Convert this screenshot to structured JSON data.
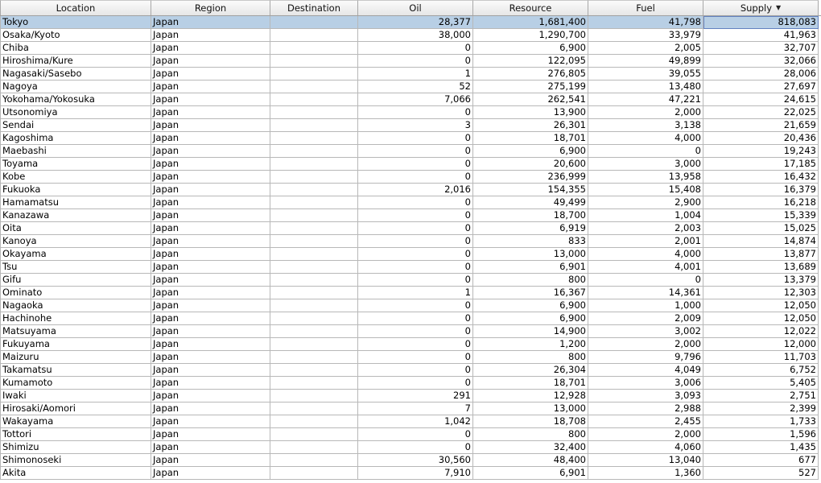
{
  "columns": [
    {
      "label": "Location",
      "align": "left"
    },
    {
      "label": "Region",
      "align": "left"
    },
    {
      "label": "Destination",
      "align": "left"
    },
    {
      "label": "Oil",
      "align": "right"
    },
    {
      "label": "Resource",
      "align": "right"
    },
    {
      "label": "Fuel",
      "align": "right"
    },
    {
      "label": "Supply",
      "align": "right",
      "sorted": "descending",
      "sort_icon": "sort-descending-icon"
    }
  ],
  "selected_row": 0,
  "colors": {
    "selection": "#b8cfe5",
    "focus_border": "#6382bf",
    "grid": "#b8b8b8"
  },
  "rows": [
    [
      "Tokyo",
      "Japan",
      "",
      "28,377",
      "1,681,400",
      "41,798",
      "818,083"
    ],
    [
      "Osaka/Kyoto",
      "Japan",
      "",
      "38,000",
      "1,290,700",
      "33,979",
      "41,963"
    ],
    [
      "Chiba",
      "Japan",
      "",
      "0",
      "6,900",
      "2,005",
      "32,707"
    ],
    [
      "Hiroshima/Kure",
      "Japan",
      "",
      "0",
      "122,095",
      "49,899",
      "32,066"
    ],
    [
      "Nagasaki/Sasebo",
      "Japan",
      "",
      "1",
      "276,805",
      "39,055",
      "28,006"
    ],
    [
      "Nagoya",
      "Japan",
      "",
      "52",
      "275,199",
      "13,480",
      "27,697"
    ],
    [
      "Yokohama/Yokosuka",
      "Japan",
      "",
      "7,066",
      "262,541",
      "47,221",
      "24,615"
    ],
    [
      "Utsonomiya",
      "Japan",
      "",
      "0",
      "13,900",
      "2,000",
      "22,025"
    ],
    [
      "Sendai",
      "Japan",
      "",
      "3",
      "26,301",
      "3,138",
      "21,659"
    ],
    [
      "Kagoshima",
      "Japan",
      "",
      "0",
      "18,701",
      "4,000",
      "20,436"
    ],
    [
      "Maebashi",
      "Japan",
      "",
      "0",
      "6,900",
      "0",
      "19,243"
    ],
    [
      "Toyama",
      "Japan",
      "",
      "0",
      "20,600",
      "3,000",
      "17,185"
    ],
    [
      "Kobe",
      "Japan",
      "",
      "0",
      "236,999",
      "13,958",
      "16,432"
    ],
    [
      "Fukuoka",
      "Japan",
      "",
      "2,016",
      "154,355",
      "15,408",
      "16,379"
    ],
    [
      "Hamamatsu",
      "Japan",
      "",
      "0",
      "49,499",
      "2,900",
      "16,218"
    ],
    [
      "Kanazawa",
      "Japan",
      "",
      "0",
      "18,700",
      "1,004",
      "15,339"
    ],
    [
      "Oita",
      "Japan",
      "",
      "0",
      "6,919",
      "2,003",
      "15,025"
    ],
    [
      "Kanoya",
      "Japan",
      "",
      "0",
      "833",
      "2,001",
      "14,874"
    ],
    [
      "Okayama",
      "Japan",
      "",
      "0",
      "13,000",
      "4,000",
      "13,877"
    ],
    [
      "Tsu",
      "Japan",
      "",
      "0",
      "6,901",
      "4,001",
      "13,689"
    ],
    [
      "Gifu",
      "Japan",
      "",
      "0",
      "800",
      "0",
      "13,379"
    ],
    [
      "Ominato",
      "Japan",
      "",
      "1",
      "16,367",
      "14,361",
      "12,303"
    ],
    [
      "Nagaoka",
      "Japan",
      "",
      "0",
      "6,900",
      "1,000",
      "12,050"
    ],
    [
      "Hachinohe",
      "Japan",
      "",
      "0",
      "6,900",
      "2,009",
      "12,050"
    ],
    [
      "Matsuyama",
      "Japan",
      "",
      "0",
      "14,900",
      "3,002",
      "12,022"
    ],
    [
      "Fukuyama",
      "Japan",
      "",
      "0",
      "1,200",
      "2,000",
      "12,000"
    ],
    [
      "Maizuru",
      "Japan",
      "",
      "0",
      "800",
      "9,796",
      "11,703"
    ],
    [
      "Takamatsu",
      "Japan",
      "",
      "0",
      "26,304",
      "4,049",
      "6,752"
    ],
    [
      "Kumamoto",
      "Japan",
      "",
      "0",
      "18,701",
      "3,006",
      "5,405"
    ],
    [
      "Iwaki",
      "Japan",
      "",
      "291",
      "12,928",
      "3,093",
      "2,751"
    ],
    [
      "Hirosaki/Aomori",
      "Japan",
      "",
      "7",
      "13,000",
      "2,988",
      "2,399"
    ],
    [
      "Wakayama",
      "Japan",
      "",
      "1,042",
      "18,708",
      "2,455",
      "1,733"
    ],
    [
      "Tottori",
      "Japan",
      "",
      "0",
      "800",
      "2,000",
      "1,596"
    ],
    [
      "Shimizu",
      "Japan",
      "",
      "0",
      "32,400",
      "4,060",
      "1,435"
    ],
    [
      "Shimonoseki",
      "Japan",
      "",
      "30,560",
      "48,400",
      "13,040",
      "677"
    ],
    [
      "Akita",
      "Japan",
      "",
      "7,910",
      "6,901",
      "1,360",
      "527"
    ]
  ]
}
